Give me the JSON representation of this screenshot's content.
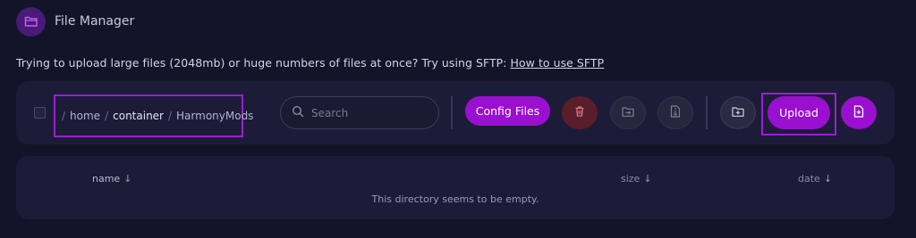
{
  "header": {
    "title": "File Manager",
    "icon": "folder-icon"
  },
  "notice": {
    "text": "Trying to upload large files (2048mb) or huge numbers of files at once? Try using SFTP:",
    "link": "How to use SFTP"
  },
  "breadcrumbs": [
    "home",
    "container",
    "HarmonyMods"
  ],
  "search": {
    "placeholder": "Search",
    "value": ""
  },
  "toolbar": {
    "config_files_label": "Config Files",
    "upload_label": "Upload"
  },
  "table": {
    "columns": [
      {
        "label": "name",
        "sort": "↓"
      },
      {
        "label": "size",
        "sort": "↓"
      },
      {
        "label": "date",
        "sort": "↓"
      }
    ],
    "empty_message": "This directory seems to be empty."
  },
  "colors": {
    "accent": "#9a0fd0",
    "background": "#13132a",
    "panel": "#1c1c38",
    "danger": "#5a1e2a"
  }
}
